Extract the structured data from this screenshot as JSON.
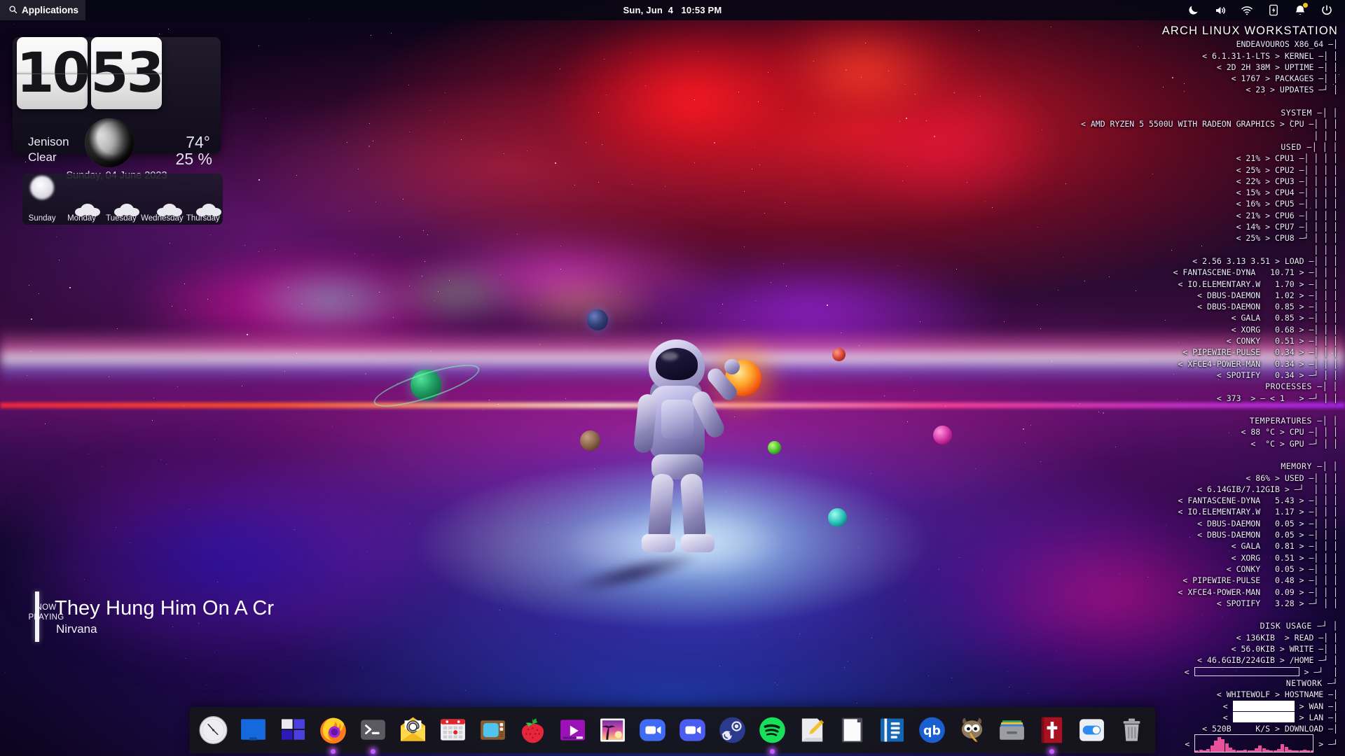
{
  "panel": {
    "applications_label": "Applications",
    "search_icon": "search-icon",
    "clock": "Sun, Jun  4   10:53 PM",
    "tray": [
      {
        "name": "night-mode-icon",
        "label": "Night Mode"
      },
      {
        "name": "volume-icon",
        "label": "Volume"
      },
      {
        "name": "wifi-icon",
        "label": "Wi-Fi"
      },
      {
        "name": "battery-icon",
        "label": "Battery"
      },
      {
        "name": "notification-bell-icon",
        "label": "Notifications"
      },
      {
        "name": "power-icon",
        "label": "Power"
      }
    ]
  },
  "clock_widget": {
    "hours": "10",
    "minutes": "53",
    "city": "Jenison",
    "condition": "Clear",
    "temperature": "74°",
    "humidity": "25 %",
    "date": "Sunday, 04 June 2023",
    "forecast": [
      {
        "day": "Sunday",
        "icon": "sun-icon"
      },
      {
        "day": "Monday",
        "icon": "cloud-icon"
      },
      {
        "day": "Tuesday",
        "icon": "cloud-icon"
      },
      {
        "day": "Wednesday",
        "icon": "cloud-icon"
      },
      {
        "day": "Thursday",
        "icon": "cloud-icon"
      }
    ]
  },
  "now_playing": {
    "kicker_line1": "NOW",
    "kicker_line2": "PLAYING",
    "title": "They Hung Him On A Cr",
    "artist": "Nirvana"
  },
  "conky": {
    "title": "ARCH LINUX WORKSTATION",
    "distro": "ENDEAVOUROS X86_64",
    "kernel_value": "6.1.31-1-LTS",
    "kernel_label": "KERNEL",
    "uptime_value": "2D 2H 38M",
    "uptime_label": "UPTIME",
    "packages_value": "1767",
    "packages_label": "PACKAGES",
    "updates_value": "23",
    "updates_label": "UPDATES",
    "system_label": "SYSTEM",
    "cpu_model": "AMD RYZEN 5 5500U WITH RADEON GRAPHICS",
    "cpu_label": "CPU",
    "used_label": "USED",
    "cores": [
      {
        "value": "21%",
        "label": "CPU1"
      },
      {
        "value": "25%",
        "label": "CPU2"
      },
      {
        "value": "22%",
        "label": "CPU3"
      },
      {
        "value": "15%",
        "label": "CPU4"
      },
      {
        "value": "16%",
        "label": "CPU5"
      },
      {
        "value": "21%",
        "label": "CPU6"
      },
      {
        "value": "14%",
        "label": "CPU7"
      },
      {
        "value": "25%",
        "label": "CPU8"
      }
    ],
    "load_value": "2.56 3.13 3.51",
    "load_label": "LOAD",
    "cpu_processes": [
      {
        "name": "FANTASCENE-DYNA",
        "value": "10.71"
      },
      {
        "name": "IO.ELEMENTARY.W",
        "value": "1.70"
      },
      {
        "name": "DBUS-DAEMON",
        "value": "1.02"
      },
      {
        "name": "DBUS-DAEMON",
        "value": "0.85"
      },
      {
        "name": "GALA",
        "value": "0.85"
      },
      {
        "name": "XORG",
        "value": "0.68"
      },
      {
        "name": "CONKY",
        "value": "0.51"
      },
      {
        "name": "PIPEWIRE-PULSE",
        "value": "0.34"
      },
      {
        "name": "XFCE4-POWER-MAN",
        "value": "0.34"
      },
      {
        "name": "SPOTIFY",
        "value": "0.34"
      }
    ],
    "processes_label": "PROCESSES",
    "processes_total": "373",
    "processes_running": "1",
    "temperatures_label": "TEMPERATURES",
    "cpu_temp": "88 °C",
    "cpu_temp_label": "CPU",
    "gpu_temp": "",
    "gpu_temp_label": "GPU",
    "memory_label": "MEMORY",
    "mem_percent": "86%",
    "mem_used_label": "USED",
    "mem_detail": "6.14GIB/7.12GIB",
    "mem_processes": [
      {
        "name": "FANTASCENE-DYNA",
        "value": "5.43"
      },
      {
        "name": "IO.ELEMENTARY.W",
        "value": "1.17"
      },
      {
        "name": "DBUS-DAEMON",
        "value": "0.05"
      },
      {
        "name": "DBUS-DAEMON",
        "value": "0.05"
      },
      {
        "name": "GALA",
        "value": "0.81"
      },
      {
        "name": "XORG",
        "value": "0.51"
      },
      {
        "name": "CONKY",
        "value": "0.05"
      },
      {
        "name": "PIPEWIRE-PULSE",
        "value": "0.48"
      },
      {
        "name": "XFCE4-POWER-MAN",
        "value": "0.09"
      },
      {
        "name": "SPOTIFY",
        "value": "3.28"
      }
    ],
    "disk_label": "DISK USAGE",
    "disk_read": "136KIB",
    "disk_read_label": "READ",
    "disk_write": "56.0KIB",
    "disk_write_label": "WRITE",
    "disk_home": "46.6GIB/224GIB",
    "disk_home_label": "/HOME",
    "network_label": "NETWORK",
    "hostname": "WHITEWOLF",
    "hostname_label": "HOSTNAME",
    "wan_label": "WAN",
    "lan_label": "LAN",
    "download_value": "520B     K/S",
    "download_label": "DOWNLOAD"
  },
  "dock": {
    "items": [
      {
        "name": "dock-item-clock",
        "label": "Clock",
        "icon": "clock-icon",
        "running": false
      },
      {
        "name": "dock-item-files",
        "label": "Files",
        "icon": "files-icon",
        "running": false
      },
      {
        "name": "dock-item-multitasking",
        "label": "Multitasking View",
        "icon": "multitasking-icon",
        "running": false
      },
      {
        "name": "dock-item-firefox",
        "label": "Firefox",
        "icon": "firefox-icon",
        "running": true
      },
      {
        "name": "dock-item-terminal",
        "label": "Terminal",
        "icon": "terminal-icon",
        "running": true
      },
      {
        "name": "dock-item-mail",
        "label": "Mail",
        "icon": "mail-icon",
        "running": false
      },
      {
        "name": "dock-item-calendar",
        "label": "Calendar",
        "icon": "calendar-icon",
        "running": false
      },
      {
        "name": "dock-item-television",
        "label": "Television",
        "icon": "tv-icon",
        "running": false
      },
      {
        "name": "dock-item-strawberry",
        "label": "Strawberry",
        "icon": "strawberry-icon",
        "running": false
      },
      {
        "name": "dock-item-video-player",
        "label": "Video Player",
        "icon": "video-player-icon",
        "running": false
      },
      {
        "name": "dock-item-photos",
        "label": "Photos",
        "icon": "photos-icon",
        "running": false
      },
      {
        "name": "dock-item-camera",
        "label": "Camera",
        "icon": "camera-icon",
        "running": false
      },
      {
        "name": "dock-item-zoom",
        "label": "Zoom",
        "icon": "zoom-video-icon",
        "running": false
      },
      {
        "name": "dock-item-steam",
        "label": "Steam",
        "icon": "steam-icon",
        "running": false
      },
      {
        "name": "dock-item-spotify",
        "label": "Spotify",
        "icon": "spotify-icon",
        "running": true
      },
      {
        "name": "dock-item-text-editor",
        "label": "Text Editor",
        "icon": "text-editor-icon",
        "running": false
      },
      {
        "name": "dock-item-document",
        "label": "Document",
        "icon": "document-icon",
        "running": false
      },
      {
        "name": "dock-item-notes",
        "label": "Notes",
        "icon": "notes-icon",
        "running": false
      },
      {
        "name": "dock-item-qbittorrent",
        "label": "qBittorrent",
        "icon": "qbittorrent-icon",
        "running": false
      },
      {
        "name": "dock-item-gimp",
        "label": "GIMP",
        "icon": "gimp-icon",
        "running": false
      },
      {
        "name": "dock-item-archive-manager",
        "label": "Archive Manager",
        "icon": "archive-icon",
        "running": false
      },
      {
        "name": "dock-item-bible",
        "label": "Bible",
        "icon": "bible-icon",
        "running": true
      },
      {
        "name": "dock-item-settings",
        "label": "System Settings",
        "icon": "settings-toggle-icon",
        "running": false
      },
      {
        "name": "dock-item-trash",
        "label": "Trash",
        "icon": "trash-icon",
        "running": false
      }
    ]
  }
}
